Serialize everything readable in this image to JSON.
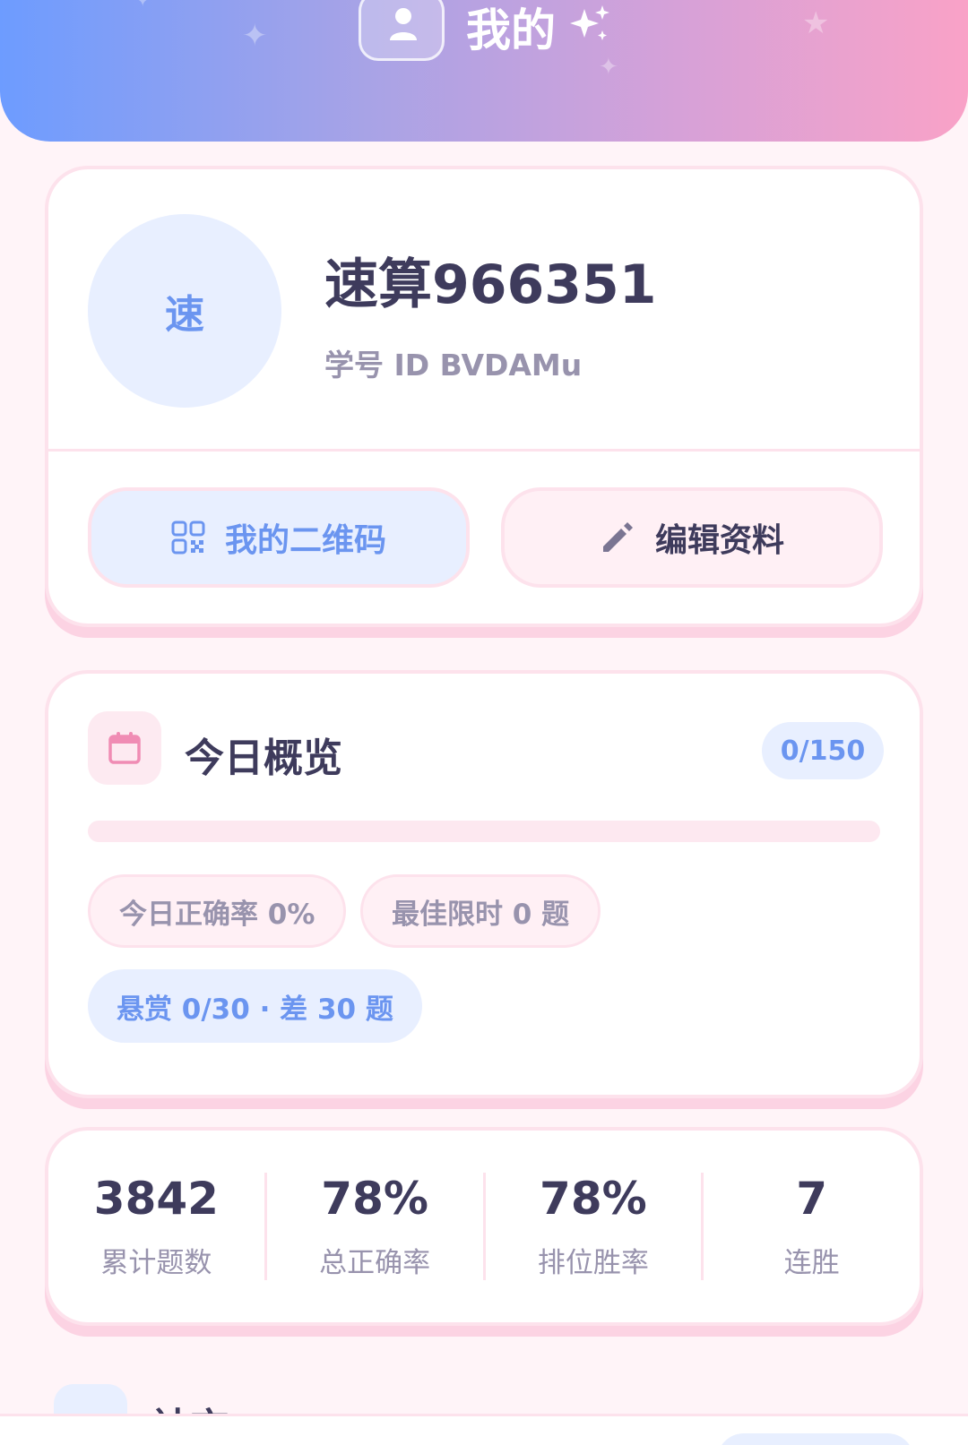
{
  "header": {
    "title": "我的",
    "avatar_icon": "person-icon",
    "sparkle_icon": "sparkles-icon"
  },
  "profile": {
    "avatar_text": "速",
    "username": "速算966351",
    "user_id": "学号 ID BVDAMu",
    "qr_button": {
      "label": "我的二维码",
      "icon": "qr-code-icon"
    },
    "edit_button": {
      "label": "编辑资料",
      "icon": "pencil-icon"
    }
  },
  "today": {
    "icon": "calendar-icon",
    "title": "今日概览",
    "badge": "0/150",
    "progress": 0,
    "chips": {
      "accuracy": "今日正确率 0%",
      "best_timed": "最佳限时 0 题",
      "bounty": "悬赏 0/30 · 差 30 题"
    }
  },
  "stats": [
    {
      "value": "3842",
      "label": "累计题数"
    },
    {
      "value": "78%",
      "label": "总正确率"
    },
    {
      "value": "78%",
      "label": "排位胜率"
    },
    {
      "value": "7",
      "label": "连胜"
    }
  ],
  "next_section": {
    "title": "社交"
  },
  "colors": {
    "accent_blue": "#6b95f0",
    "accent_pink": "#f6a8c8",
    "text_dark": "#3e3b5c",
    "text_muted": "#9893ad"
  }
}
